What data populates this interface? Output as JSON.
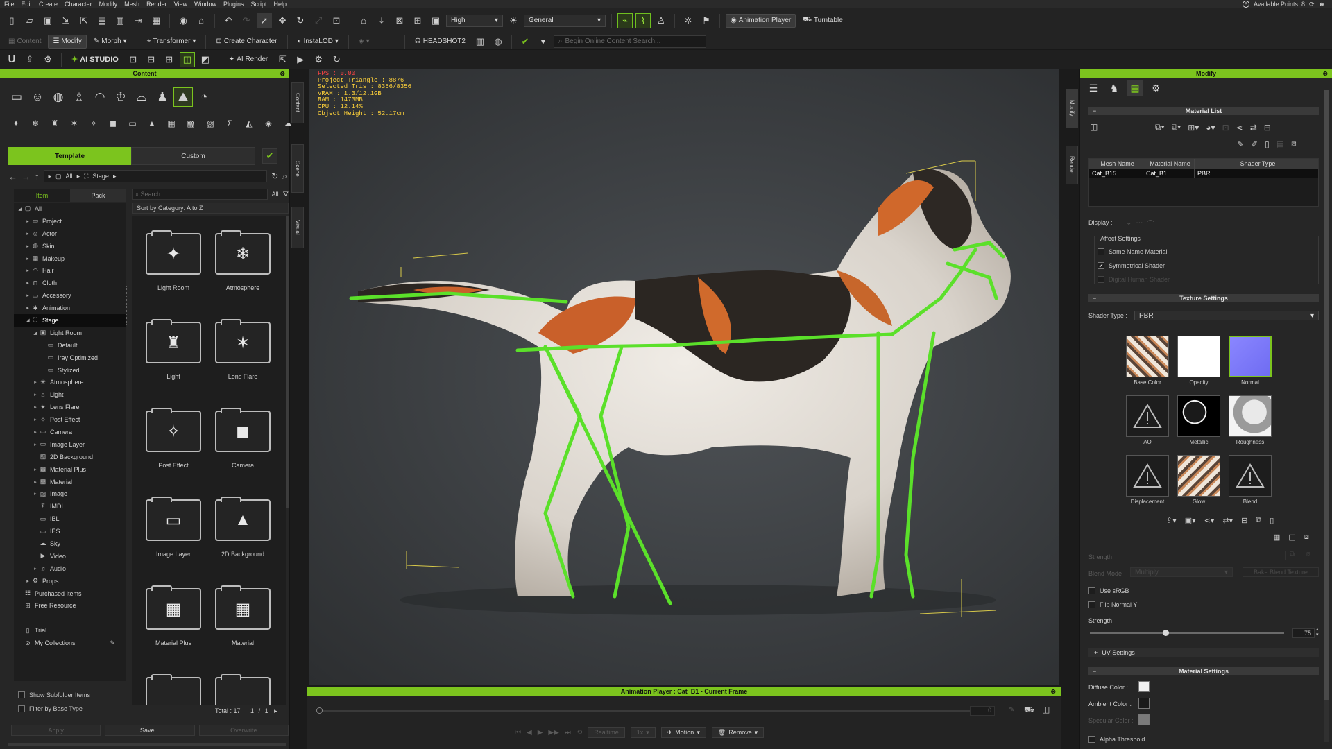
{
  "menu": [
    "File",
    "Edit",
    "Create",
    "Character",
    "Modify",
    "Mesh",
    "Render",
    "View",
    "Window",
    "Plugins",
    "Script",
    "Help"
  ],
  "available_points": "Available Points: 8",
  "toolbar1": {
    "quality": "High",
    "mode": "General",
    "animation_player": "Animation Player",
    "turntable": "Turntable"
  },
  "toolbar2": {
    "content": "Content",
    "modify": "Modify",
    "morph": "Morph",
    "transformer": "Transformer",
    "create_character": "Create Character",
    "instalod": "InstaLOD",
    "headshot": "HEADSHOT2",
    "search_placeholder": "Begin Online Content Search..."
  },
  "toolbar3": {
    "ai_studio": "AI STUDIO",
    "ai_render": "AI Render"
  },
  "content": {
    "title": "Content",
    "tabs": [
      "Template",
      "Custom"
    ],
    "path": [
      "All",
      "Stage"
    ],
    "tree_tabs": [
      "Item",
      "Pack"
    ],
    "search_placeholder": "Search",
    "filter": "All",
    "sort": "Sort by Category: A to Z",
    "tree": [
      {
        "label": "All",
        "depth": 0,
        "arrow": "◢",
        "icon": "▢"
      },
      {
        "label": "Project",
        "depth": 1,
        "arrow": "▸",
        "icon": "▭"
      },
      {
        "label": "Actor",
        "depth": 1,
        "arrow": "▸",
        "icon": "☺"
      },
      {
        "label": "Skin",
        "depth": 1,
        "arrow": "▸",
        "icon": "◍"
      },
      {
        "label": "Makeup",
        "depth": 1,
        "arrow": "▸",
        "icon": "▦"
      },
      {
        "label": "Hair",
        "depth": 1,
        "arrow": "▸",
        "icon": "◠"
      },
      {
        "label": "Cloth",
        "depth": 1,
        "arrow": "▸",
        "icon": "⊓"
      },
      {
        "label": "Accessory",
        "depth": 1,
        "arrow": "▸",
        "icon": "▭"
      },
      {
        "label": "Animation",
        "depth": 1,
        "arrow": "▸",
        "icon": "✱"
      },
      {
        "label": "Stage",
        "depth": 1,
        "arrow": "◢",
        "icon": "⛶",
        "selected": true
      },
      {
        "label": "Light Room",
        "depth": 2,
        "arrow": "◢",
        "icon": "▣"
      },
      {
        "label": "Default",
        "depth": 3,
        "arrow": "",
        "icon": "▭"
      },
      {
        "label": "Iray Optimized",
        "depth": 3,
        "arrow": "",
        "icon": "▭"
      },
      {
        "label": "Stylized",
        "depth": 3,
        "arrow": "",
        "icon": "▭"
      },
      {
        "label": "Atmosphere",
        "depth": 2,
        "arrow": "▸",
        "icon": "✳"
      },
      {
        "label": "Light",
        "depth": 2,
        "arrow": "▸",
        "icon": "⌂"
      },
      {
        "label": "Lens Flare",
        "depth": 2,
        "arrow": "▸",
        "icon": "✴"
      },
      {
        "label": "Post Effect",
        "depth": 2,
        "arrow": "▸",
        "icon": "✧"
      },
      {
        "label": "Camera",
        "depth": 2,
        "arrow": "▸",
        "icon": "▭"
      },
      {
        "label": "Image Layer",
        "depth": 2,
        "arrow": "▸",
        "icon": "▭"
      },
      {
        "label": "2D Background",
        "depth": 2,
        "arrow": "",
        "icon": "▨"
      },
      {
        "label": "Material Plus",
        "depth": 2,
        "arrow": "▸",
        "icon": "▩"
      },
      {
        "label": "Material",
        "depth": 2,
        "arrow": "▸",
        "icon": "▩"
      },
      {
        "label": "Image",
        "depth": 2,
        "arrow": "▸",
        "icon": "▨"
      },
      {
        "label": "IMDL",
        "depth": 2,
        "arrow": "",
        "icon": "Σ"
      },
      {
        "label": "IBL",
        "depth": 2,
        "arrow": "",
        "icon": "▭"
      },
      {
        "label": "IES",
        "depth": 2,
        "arrow": "",
        "icon": "▭"
      },
      {
        "label": "Sky",
        "depth": 2,
        "arrow": "",
        "icon": "☁"
      },
      {
        "label": "Video",
        "depth": 2,
        "arrow": "",
        "icon": "▶"
      },
      {
        "label": "Audio",
        "depth": 2,
        "arrow": "▸",
        "icon": "♫"
      },
      {
        "label": "Props",
        "depth": 1,
        "arrow": "▸",
        "icon": "⚙"
      },
      {
        "label": "Purchased Items",
        "depth": 0,
        "arrow": "",
        "icon": "☷"
      },
      {
        "label": "Free Resource",
        "depth": 0,
        "arrow": "",
        "icon": "⊞"
      },
      {
        "label": "",
        "depth": 0,
        "arrow": "",
        "icon": ""
      },
      {
        "label": "Trial",
        "depth": 0,
        "arrow": "",
        "icon": "▯"
      },
      {
        "label": "My Collections",
        "depth": 0,
        "arrow": "",
        "icon": "⊘"
      }
    ],
    "grid": [
      {
        "label": "Light Room",
        "glyph": "✦"
      },
      {
        "label": "Atmosphere",
        "glyph": "❄"
      },
      {
        "label": "Light",
        "glyph": "♜"
      },
      {
        "label": "Lens Flare",
        "glyph": "✶"
      },
      {
        "label": "Post Effect",
        "glyph": "✧"
      },
      {
        "label": "Camera",
        "glyph": "◼"
      },
      {
        "label": "Image Layer",
        "glyph": "▭"
      },
      {
        "label": "2D Background",
        "glyph": "▲"
      },
      {
        "label": "Material Plus",
        "glyph": "▦"
      },
      {
        "label": "Material",
        "glyph": "▦"
      },
      {
        "label": "",
        "glyph": ""
      },
      {
        "label": "",
        "glyph": ""
      }
    ],
    "show_subfolder": "Show Subfolder Items",
    "filter_base": "Filter by Base Type",
    "total": "Total : 17",
    "page": "1",
    "page_sep": "/",
    "pages": "1",
    "apply": "Apply",
    "save": "Save...",
    "overwrite": "Overwrite"
  },
  "side_tabs": [
    "Content",
    "Scene",
    "Visual"
  ],
  "right_tabs": [
    "Modify",
    "Render"
  ],
  "viewport_stats": {
    "fps": "FPS : 0.00",
    "lines": [
      "Project Triangle : 8876",
      "Selected Tris : 8356/8356",
      "VRAM : 1.3/12.1GB",
      "RAM : 1473MB",
      "CPU : 12.14%",
      "Object Height : 52.17cm"
    ]
  },
  "animation_player": {
    "title": "Animation Player : Cat_B1 - Current Frame",
    "frame": "0",
    "realtime": "Realtime",
    "speed": "1x",
    "motion": "Motion",
    "remove": "Remove"
  },
  "modify": {
    "title": "Modify",
    "material_list": "Material List",
    "columns": [
      "Mesh Name",
      "Material Name",
      "Shader Type"
    ],
    "row": [
      "Cat_B15",
      "Cat_B1",
      "PBR"
    ],
    "display": "Display :",
    "affect_settings": "Affect Settings",
    "same_name": "Same Name Material",
    "symmetrical": "Symmetrical Shader",
    "digital_human": "Digital Human Shader",
    "texture_settings": "Texture Settings",
    "shader_type_label": "Shader Type :",
    "shader_type": "PBR",
    "textures": [
      "Base Color",
      "Opacity",
      "Normal",
      "AO",
      "Metallic",
      "Roughness",
      "Displacement",
      "Glow",
      "Blend"
    ],
    "strength_label_dim": "Strength",
    "blend_mode_label": "Blend Mode",
    "blend_mode": "Multiply",
    "bake_blend": "Bake Blend Texture",
    "use_srgb": "Use sRGB",
    "flip_normal": "Flip Normal Y",
    "strength": "Strength",
    "strength_value": "75",
    "strength_fraction": 0.38,
    "uv_settings": "UV Settings",
    "material_settings": "Material Settings",
    "diffuse_color": "Diffuse Color :",
    "ambient_color": "Ambient Color :",
    "specular_color": "Specular Color :",
    "alpha_threshold": "Alpha Threshold",
    "diffuse_hex": "#f2f2f2",
    "ambient_hex": "#1a1a1a",
    "specular_hex": "#7a7a7a"
  },
  "colors": {
    "accent": "#7cc41e",
    "bone": "#5be02a",
    "panel": "#262626"
  }
}
